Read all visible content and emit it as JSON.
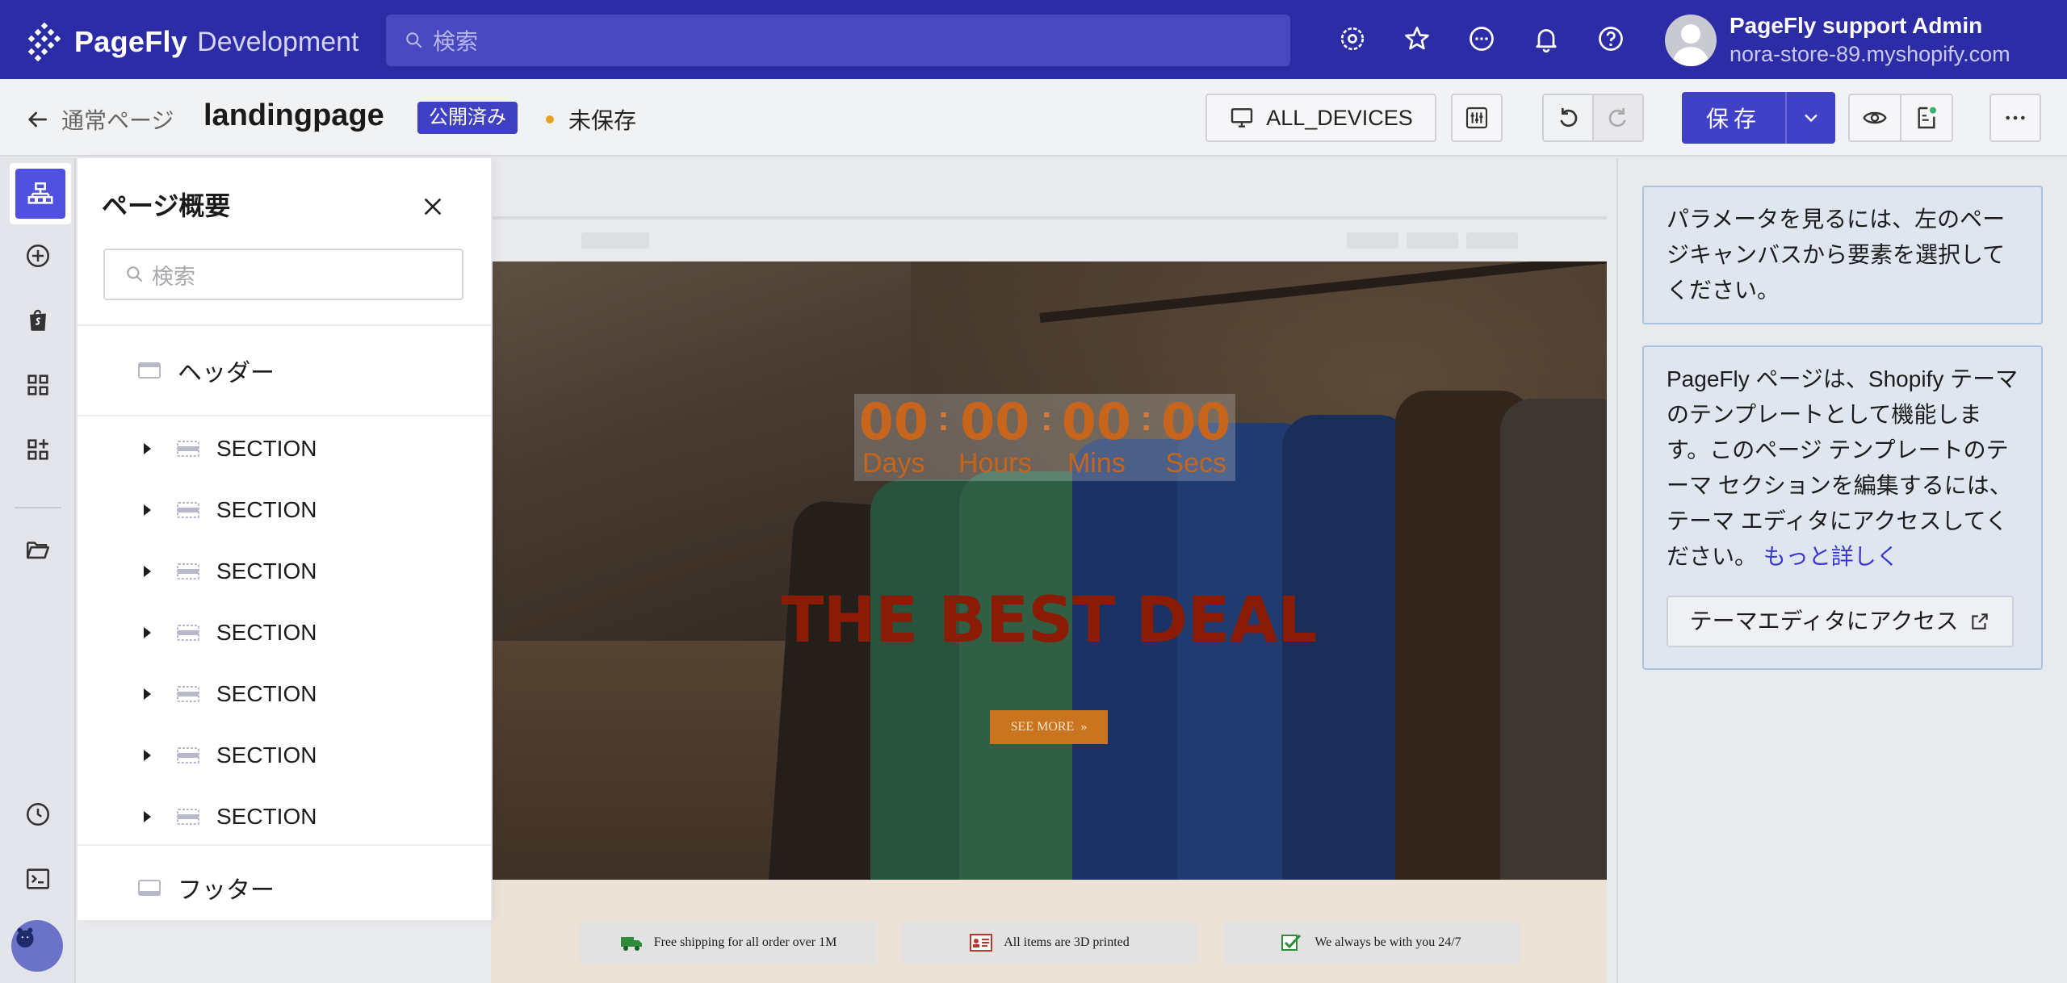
{
  "topbar": {
    "brand": "PageFly",
    "env": "Development",
    "search_placeholder": "検索",
    "user_name": "PageFly support Admin",
    "user_store": "nora-store-89.myshopify.com",
    "icons": [
      "settings-gear-icon",
      "star-icon",
      "chat-icon",
      "bell-icon",
      "help-icon"
    ]
  },
  "subbar": {
    "back_label": "通常ページ",
    "page_name": "landingpage",
    "status_badge": "公開済み",
    "unsaved_label": "未保存",
    "devices_label": "ALL_DEVICES",
    "save_label": "保存"
  },
  "outline": {
    "title": "ページ概要",
    "search_placeholder": "検索",
    "header_label": "ヘッダー",
    "sections": [
      "SECTION",
      "SECTION",
      "SECTION",
      "SECTION",
      "SECTION",
      "SECTION",
      "SECTION"
    ],
    "footer_label": "フッター"
  },
  "canvas": {
    "timer": {
      "days": "00",
      "hours": "00",
      "mins": "00",
      "secs": "00",
      "days_label": "Days",
      "hours_label": "Hours",
      "mins_label": "Mins",
      "secs_label": "Secs"
    },
    "hero_title": "THE BEST DEAL",
    "cta_label": "SEE MORE",
    "features": [
      "Free shipping for all order over 1M",
      "All items are 3D printed",
      "We always be with you 24/7"
    ]
  },
  "right_panel": {
    "info1": "パラメータを見るには、左のページキャンバスから要素を選択してください。",
    "info2": "PageFly ページは、Shopify テーマのテンプレートとして機能します。このページ テンプレートのテーマ セクションを編集するには、テーマ エディタにアクセスしてください。",
    "info2_link": "もっと詳しく",
    "access_button": "テーマエディタにアクセス"
  },
  "colors": {
    "brand_bar": "#2c2ca6",
    "accent": "#4141c8",
    "unsaved_dot": "#e6a11f",
    "timer": "#c7651d",
    "hero_title": "#8a1c06",
    "cta": "#c9741f"
  }
}
